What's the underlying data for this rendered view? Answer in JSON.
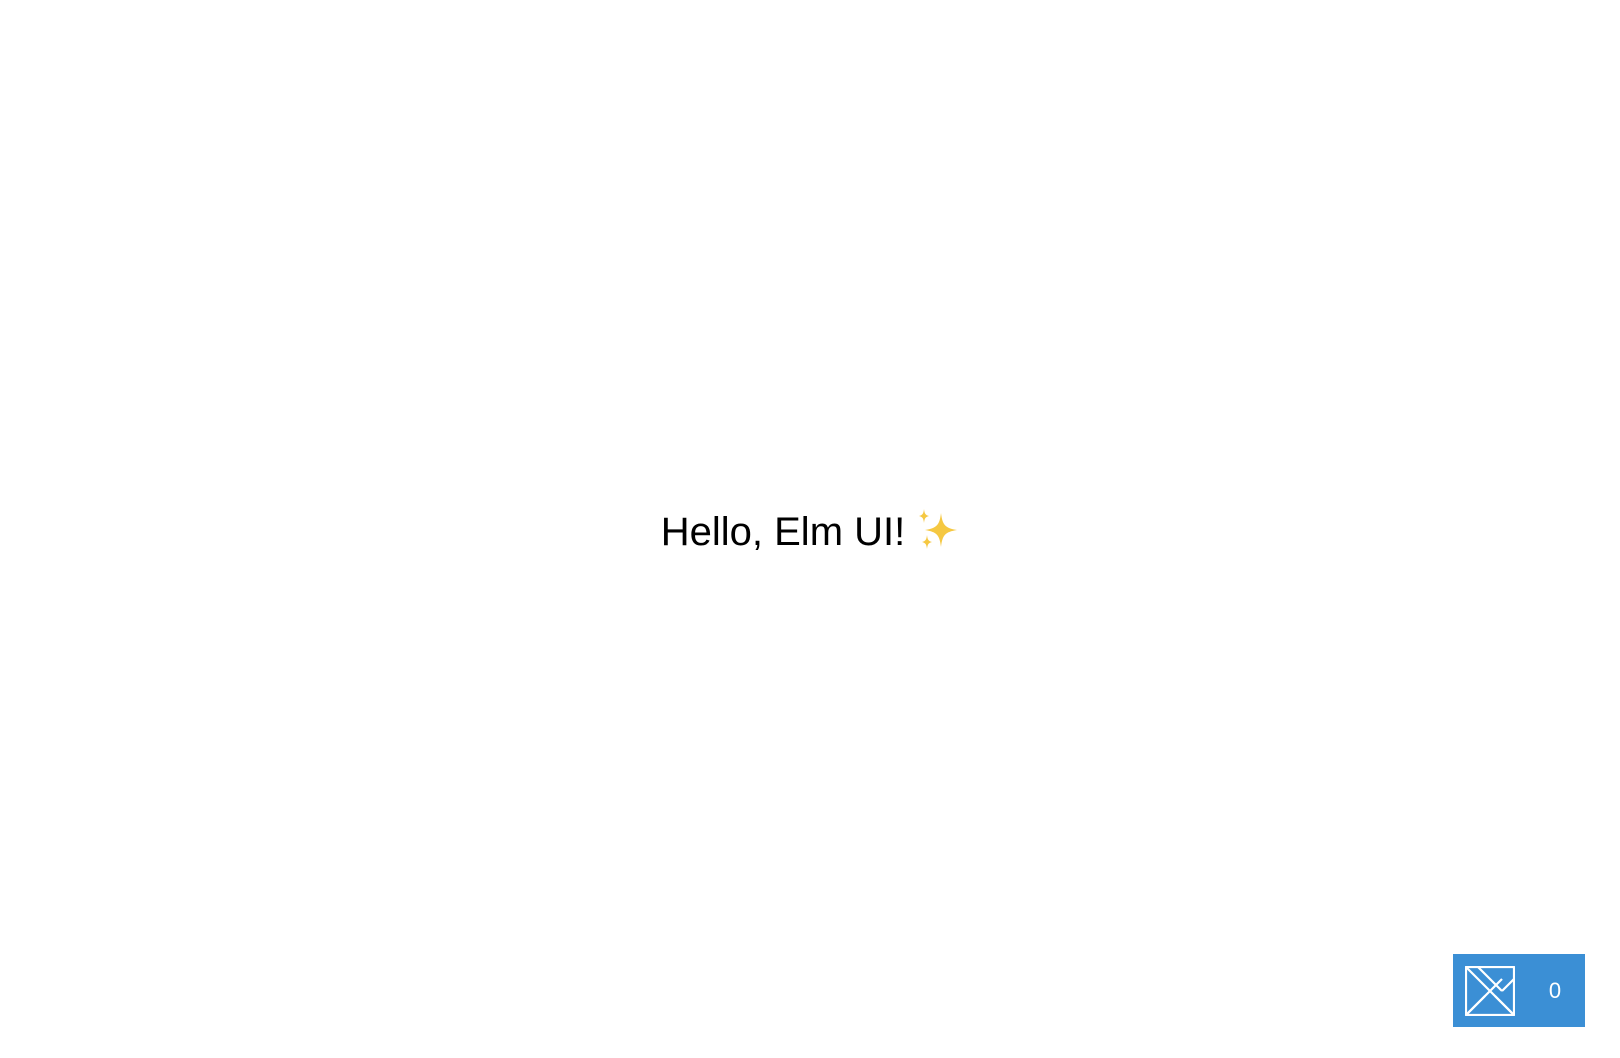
{
  "main": {
    "greeting": "Hello, Elm UI!",
    "greeting_icon": "sparkles-icon"
  },
  "debugger": {
    "logo_icon": "elm-logo-icon",
    "message_count": "0",
    "background_color": "#3b8fd5"
  }
}
